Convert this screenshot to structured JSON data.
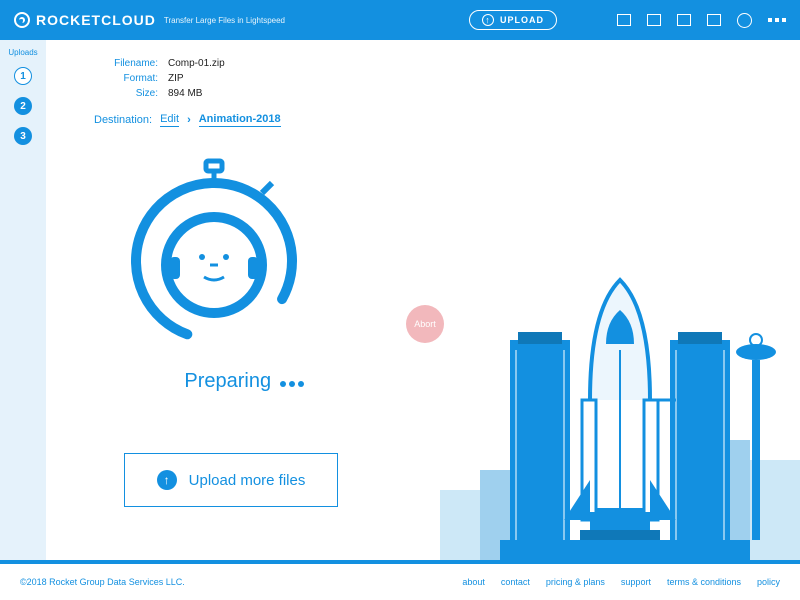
{
  "header": {
    "brand": "ROCKETCLOUD",
    "tagline": "Transfer Large Files in Lightspeed",
    "upload_label": "UPLOAD"
  },
  "sidebar": {
    "title": "Uploads",
    "steps": [
      "1",
      "2",
      "3"
    ],
    "active": 0
  },
  "file": {
    "labels": {
      "filename": "Filename:",
      "format": "Format:",
      "size": "Size:"
    },
    "filename": "Comp-01.zip",
    "format": "ZIP",
    "size": "894 MB"
  },
  "destination": {
    "label": "Destination:",
    "edit": "Edit",
    "folder": "Animation-2018"
  },
  "status": {
    "text": "Preparing",
    "abort": "Abort"
  },
  "upload_more": "Upload more files",
  "footer": {
    "copyright": "©2018 Rocket Group Data Services LLC.",
    "links": [
      "about",
      "contact",
      "pricing & plans",
      "support",
      "terms & conditions",
      "policy"
    ]
  }
}
